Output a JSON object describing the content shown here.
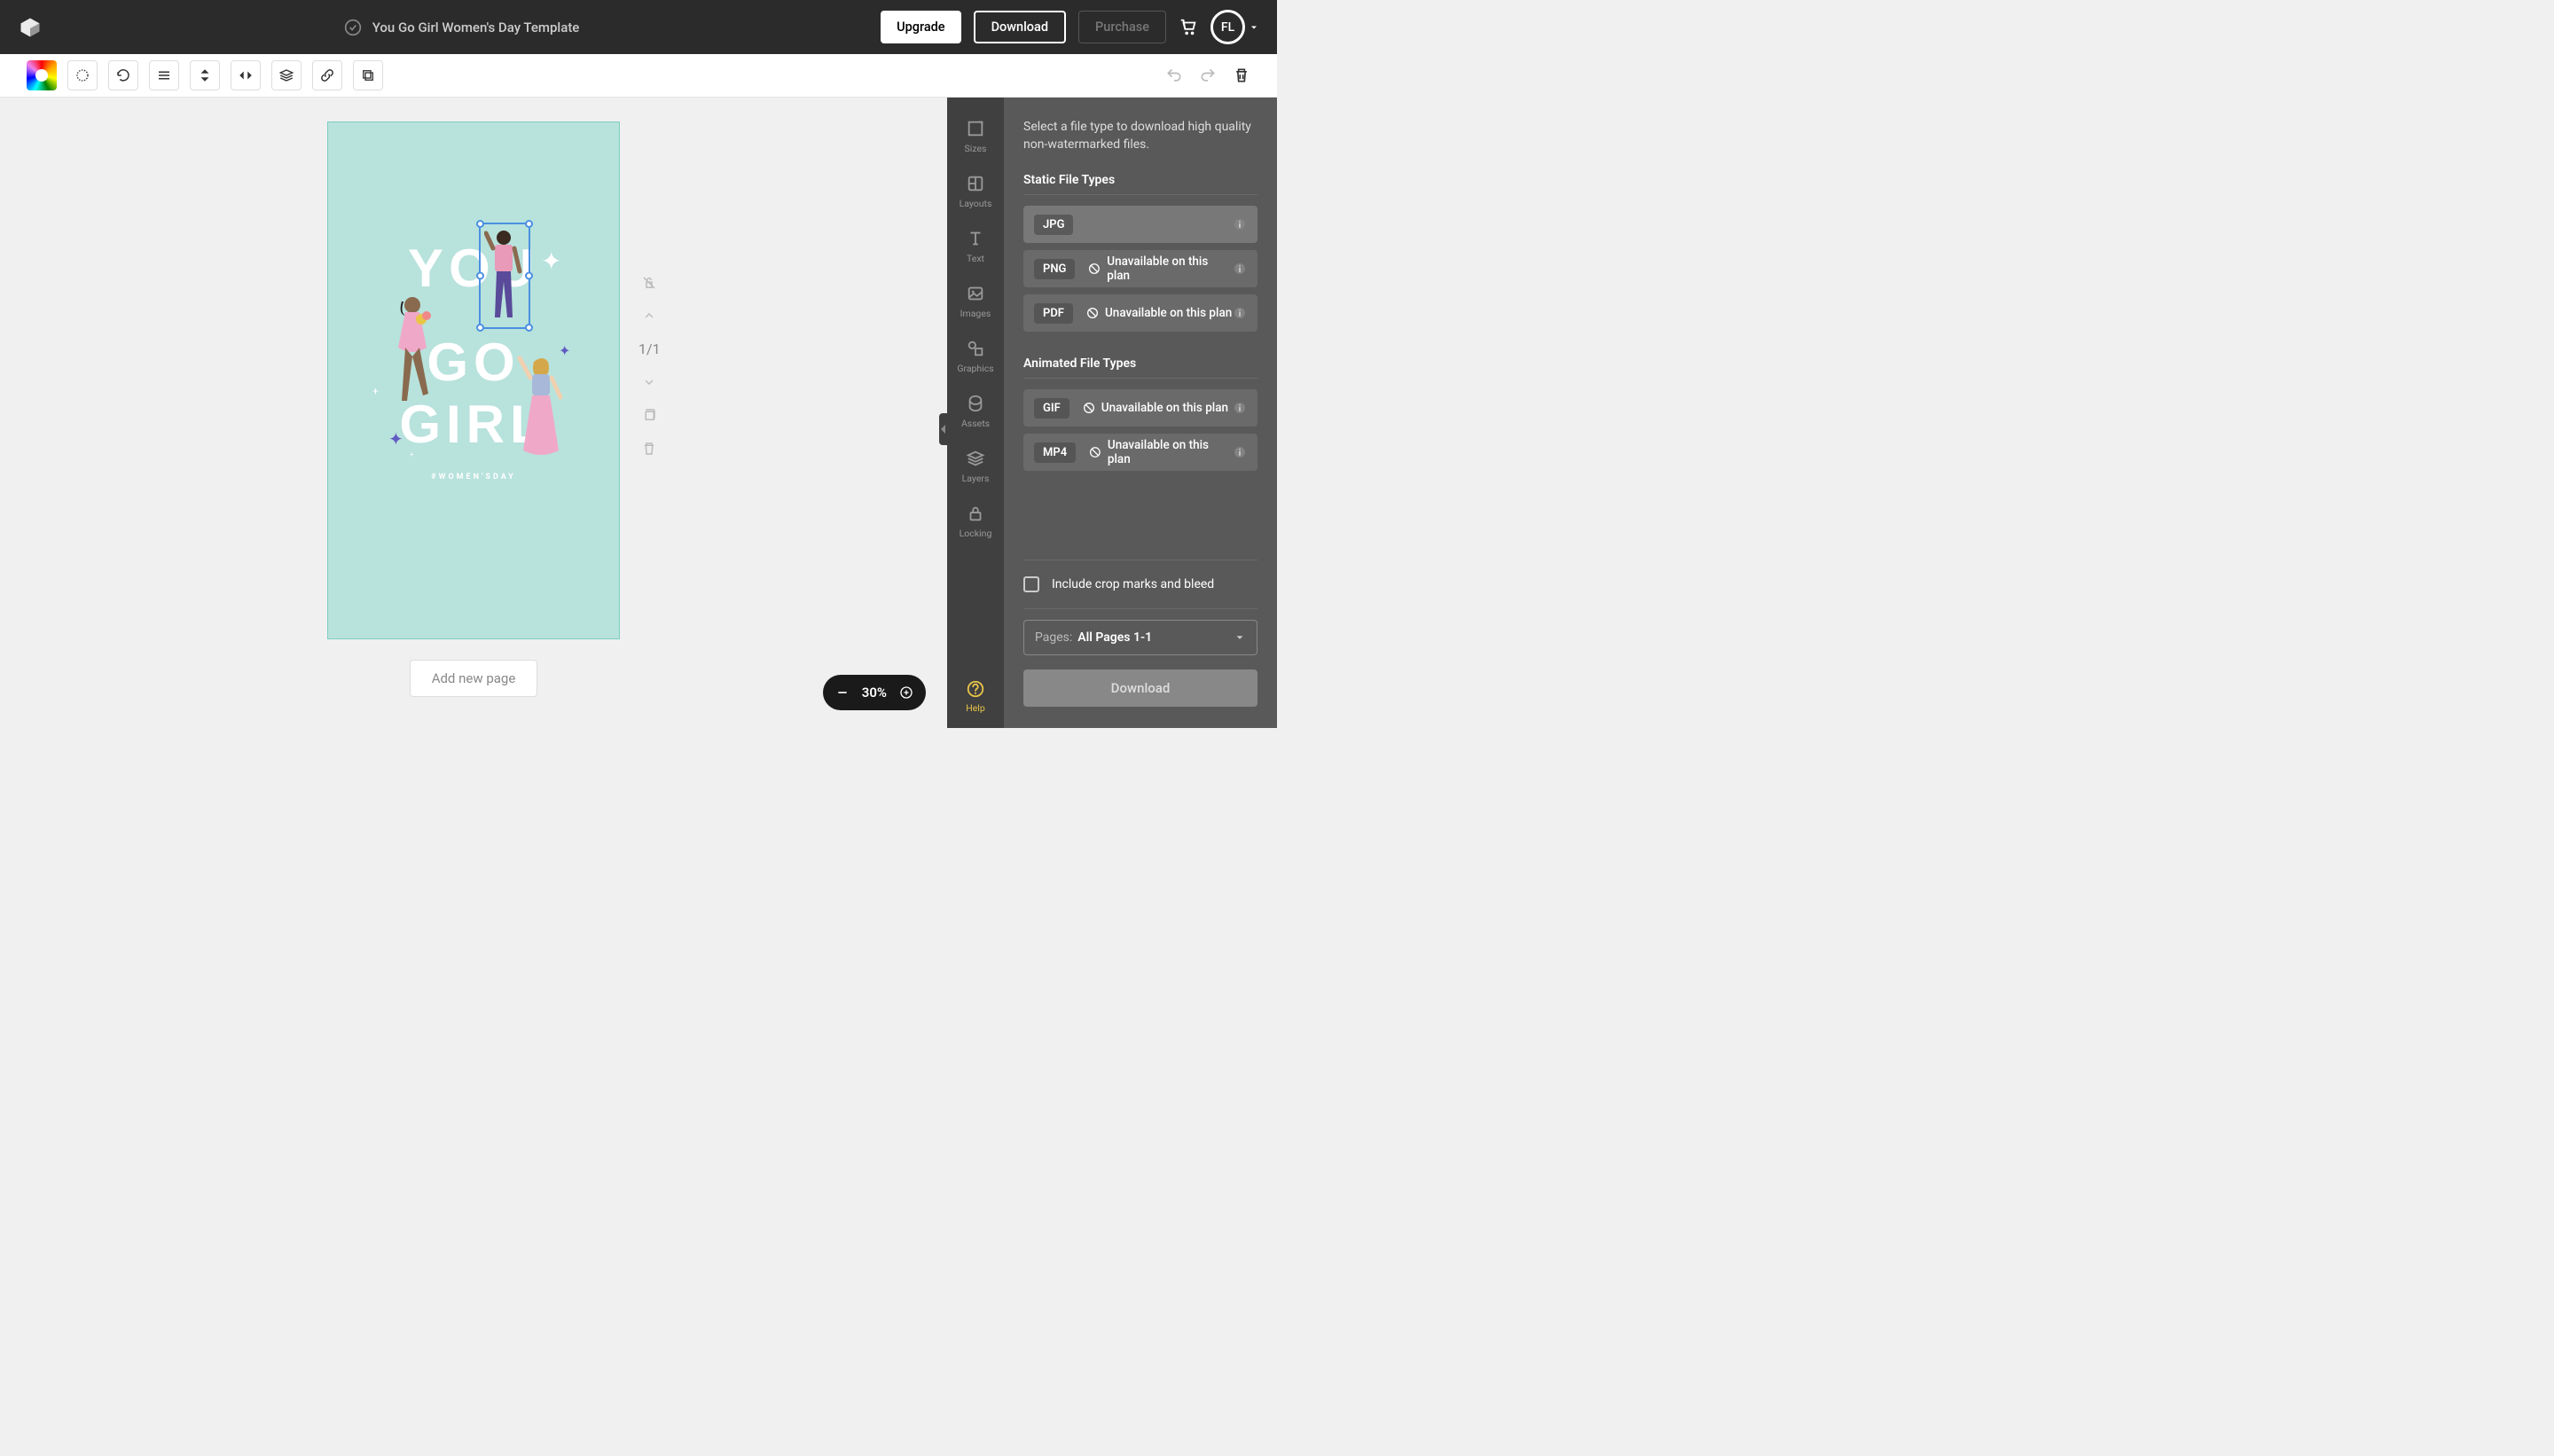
{
  "header": {
    "title": "You Go Girl Women's Day Template",
    "upgrade_label": "Upgrade",
    "download_label": "Download",
    "purchase_label": "Purchase",
    "avatar_initials": "FL"
  },
  "canvas": {
    "text_line1": "YOU",
    "text_line2": "GO",
    "text_line3": "GIRL",
    "hashtag": "#WOMEN'SDAY"
  },
  "page_controls": {
    "page_indicator": "1/1"
  },
  "add_page_label": "Add new page",
  "zoom": {
    "level": "30%"
  },
  "side_nav": {
    "items": [
      {
        "label": "Sizes"
      },
      {
        "label": "Layouts"
      },
      {
        "label": "Text"
      },
      {
        "label": "Images"
      },
      {
        "label": "Graphics"
      },
      {
        "label": "Assets"
      },
      {
        "label": "Layers"
      },
      {
        "label": "Locking"
      }
    ],
    "help_label": "Help"
  },
  "download_panel": {
    "description": "Select a file type to download high quality non-watermarked files.",
    "static_title": "Static File Types",
    "animated_title": "Animated File Types",
    "unavailable_text": "Unavailable on this plan",
    "types": {
      "jpg": "JPG",
      "png": "PNG",
      "pdf": "PDF",
      "gif": "GIF",
      "mp4": "MP4"
    },
    "crop_marks_label": "Include crop marks and bleed",
    "pages_label": "Pages:",
    "pages_value": "All Pages 1-1",
    "download_button": "Download"
  }
}
